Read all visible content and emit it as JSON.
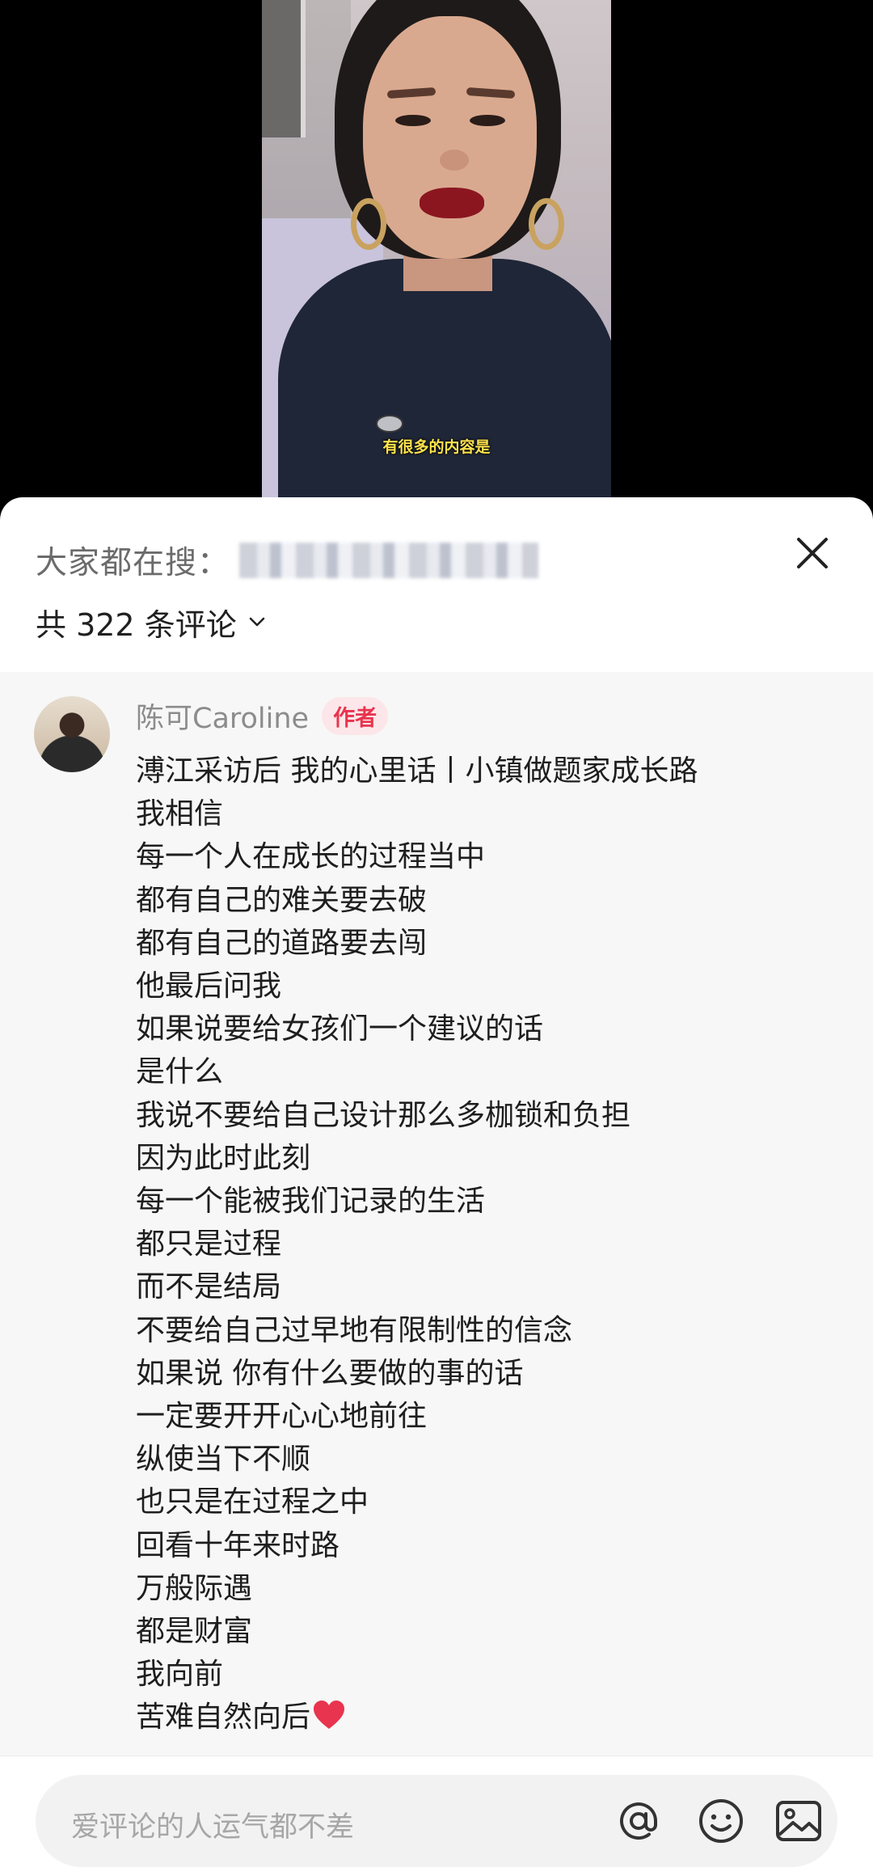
{
  "video": {
    "subtitle": "有很多的内容是"
  },
  "sheet": {
    "search_label": "大家都在搜：",
    "comment_count_label": "共 322 条评论",
    "icons": {
      "close": "close-icon",
      "dropdown": "chevron-down-icon"
    }
  },
  "comment": {
    "author": "陈可Caroline",
    "badge": "作者",
    "lines": [
      "溥江采访后 我的心里话丨小镇做题家成长路",
      "我相信",
      "每一个人在成长的过程当中",
      "都有自己的难关要去破",
      "都有自己的道路要去闯",
      "他最后问我",
      "如果说要给女孩们一个建议的话",
      "是什么",
      "我说不要给自己设计那么多枷锁和负担",
      "因为此时此刻",
      "每一个能被我们记录的生活",
      "都只是过程",
      "而不是结局",
      "不要给自己过早地有限制性的信念",
      "如果说 你有什么要做的事的话",
      "一定要开开心心地前往",
      "纵使当下不顺",
      "也只是在过程之中",
      "回看十年来时路",
      "万般际遇",
      "都是财富",
      "我向前",
      "苦难自然向后"
    ],
    "emoji": "heart-emoji"
  },
  "input": {
    "placeholder": "爱评论的人运气都不差",
    "icons": [
      "at-icon",
      "emoji-icon",
      "image-icon"
    ]
  },
  "colors": {
    "badge_text": "#e8344e",
    "badge_bg": "#fde6e9",
    "heart": "#e8344e",
    "subtitle": "#ffe34d"
  }
}
